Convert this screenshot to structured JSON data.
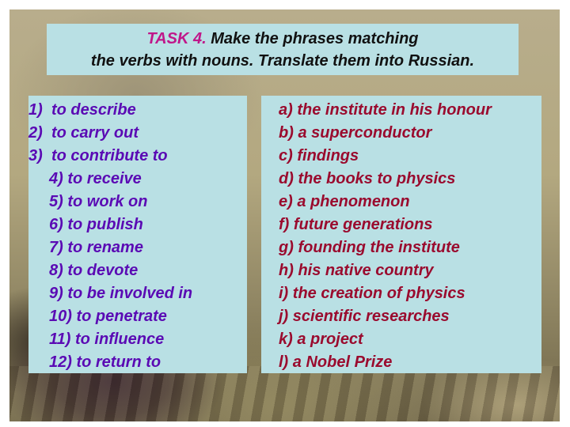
{
  "title": {
    "task_label": "TASK 4.",
    "line1_rest": " Make the phrases matching",
    "line2": "the verbs with nouns. Translate them into Russian."
  },
  "colors": {
    "panel_bg": "#b9e0e4",
    "task_label": "#c0178a",
    "verbs_text": "#5a0ab4",
    "nouns_text": "#9a0b2e",
    "title_text": "#111111"
  },
  "verbs": [
    {
      "num": "1)",
      "text": "to describe"
    },
    {
      "num": "2)",
      "text": "to carry out"
    },
    {
      "num": "3)",
      "text": "to contribute to"
    },
    {
      "num": "4)",
      "text": "to receive"
    },
    {
      "num": "5)",
      "text": "to work on"
    },
    {
      "num": "6)",
      "text": "to publish"
    },
    {
      "num": "7)",
      "text": "to rename"
    },
    {
      "num": "8)",
      "text": "to devote"
    },
    {
      "num": "9)",
      "text": "to be involved in"
    },
    {
      "num": "10)",
      "text": "to penetrate"
    },
    {
      "num": "11)",
      "text": "to influence"
    },
    {
      "num": "12)",
      "text": "to return to"
    }
  ],
  "nouns": [
    {
      "letter": "a)",
      "text": "the institute in his honour"
    },
    {
      "letter": "b)",
      "text": "a superconductor"
    },
    {
      "letter": "c)",
      "text": "findings"
    },
    {
      "letter": "d)",
      "text": "the books to physics"
    },
    {
      "letter": "e)",
      "text": "a phenomenon"
    },
    {
      "letter": "f)",
      "text": "future generations"
    },
    {
      "letter": "g)",
      "text": "founding the institute"
    },
    {
      "letter": "h)",
      "text": "his native country"
    },
    {
      "letter": "i)",
      "text": "the creation of physics"
    },
    {
      "letter": "j)",
      "text": "scientific researches"
    },
    {
      "letter": "k)",
      "text": "a project"
    },
    {
      "letter": "l)",
      "text": "a Nobel Prize"
    }
  ]
}
